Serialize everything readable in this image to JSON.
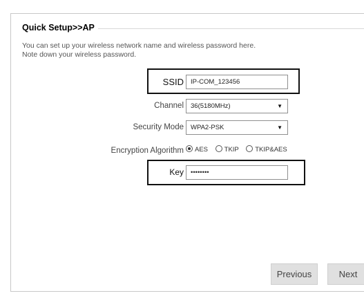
{
  "header": {
    "title": "Quick Setup>>AP"
  },
  "intro": {
    "line1": "You can set up your wireless network name and wireless password here.",
    "line2": "Note down your wireless password."
  },
  "form": {
    "ssid": {
      "label": "SSID",
      "value": "IP-COM_123456"
    },
    "channel": {
      "label": "Channel",
      "selected": "36(5180MHz)"
    },
    "security_mode": {
      "label": "Security Mode",
      "selected": "WPA2-PSK"
    },
    "encryption": {
      "label": "Encryption Algorithm",
      "options": [
        "AES",
        "TKIP",
        "TKIP&AES"
      ],
      "selected": "AES"
    },
    "key": {
      "label": "Key",
      "value": "••••••••"
    }
  },
  "buttons": {
    "previous": "Previous",
    "next": "Next"
  }
}
